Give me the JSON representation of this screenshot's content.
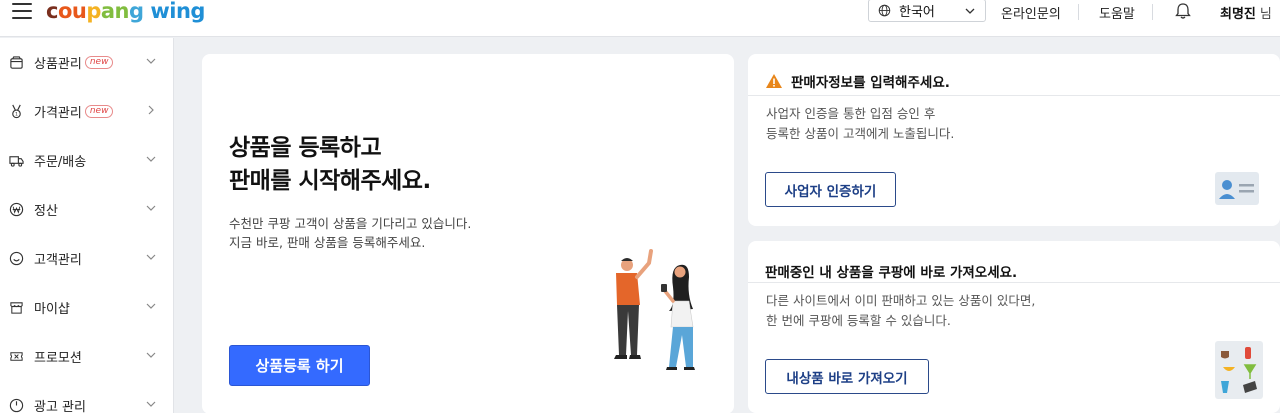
{
  "header": {
    "logo_part1": "coupang",
    "logo_part2": "wing",
    "language": "한국어",
    "inquiry": "온라인문의",
    "help": "도움말",
    "user_name": "최명진",
    "user_honorific": "님"
  },
  "sidebar": {
    "items": [
      {
        "label": "상품관리",
        "badge": "new",
        "icon": "box-icon",
        "chevron": "down"
      },
      {
        "label": "가격관리",
        "badge": "new",
        "icon": "medal-icon",
        "chevron": "right"
      },
      {
        "label": "주문/배송",
        "badge": "",
        "icon": "truck-icon",
        "chevron": "down"
      },
      {
        "label": "정산",
        "badge": "",
        "icon": "won-coin-icon",
        "chevron": "down"
      },
      {
        "label": "고객관리",
        "badge": "",
        "icon": "smile-icon",
        "chevron": "down"
      },
      {
        "label": "마이샵",
        "badge": "",
        "icon": "shop-icon",
        "chevron": "down"
      },
      {
        "label": "프로모션",
        "badge": "",
        "icon": "ticket-icon",
        "chevron": "down"
      },
      {
        "label": "광고 관리",
        "badge": "",
        "icon": "gauge-icon",
        "chevron": "down"
      }
    ]
  },
  "main_card": {
    "title_line1": "상품을 등록하고",
    "title_line2": "판매를 시작해주세요.",
    "desc_line1": "수천만 쿠팡 고객이 상품을 기다리고 있습니다.",
    "desc_line2": "지금 바로, 판매 상품을 등록해주세요.",
    "button": "상품등록 하기"
  },
  "seller_card": {
    "title": "판매자정보를 입력해주세요.",
    "desc_line1": "사업자 인증을 통한 입점 승인 후",
    "desc_line2": "등록한 상품이 고객에게 노출됩니다.",
    "button": "사업자 인증하기"
  },
  "import_card": {
    "title": "판매중인 내 상품을 쿠팡에 바로 가져오세요.",
    "desc_line1": "다른 사이트에서 이미 판매하고 있는 상품이 있다면,",
    "desc_line2": "한 번에 쿠팡에 등록할 수 있습니다.",
    "button": "내상품 바로 가져오기"
  },
  "colors": {
    "primary_button": "#346aff",
    "outline_button": "#1d3f86",
    "warning": "#e8861a",
    "new_badge": "#e04646",
    "background": "#eef0f3"
  }
}
